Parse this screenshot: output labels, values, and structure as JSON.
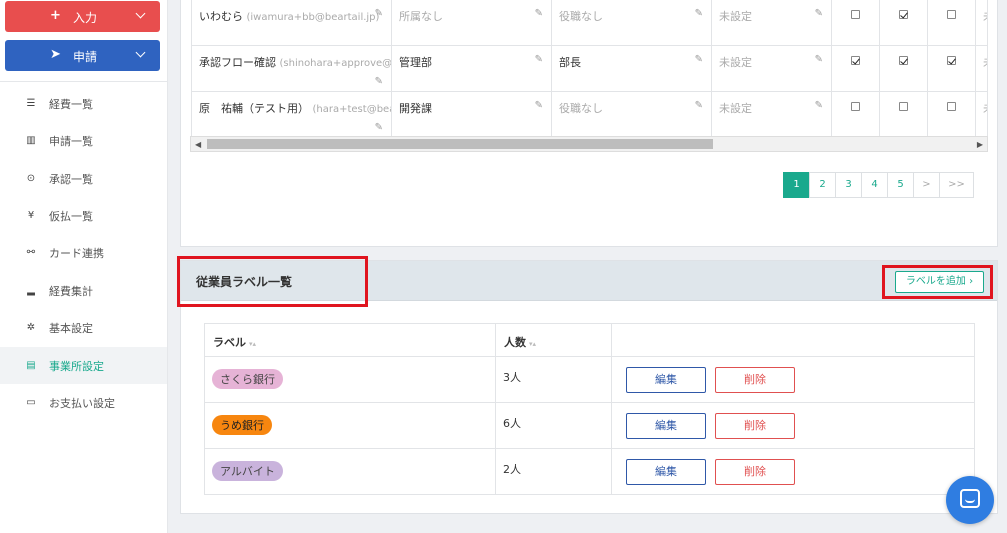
{
  "sidebar": {
    "input_button": {
      "icon": "+",
      "label": "入力"
    },
    "apply_button": {
      "icon": "➤",
      "label": "申請"
    },
    "items": [
      {
        "label": "経費一覧",
        "icon": "list-icon",
        "glyph": "☰"
      },
      {
        "label": "申請一覧",
        "icon": "bar-chart-icon",
        "glyph": "▥"
      },
      {
        "label": "承認一覧",
        "icon": "check-circle-icon",
        "glyph": "⊙"
      },
      {
        "label": "仮払一覧",
        "icon": "yen-icon",
        "glyph": "¥"
      },
      {
        "label": "カード連携",
        "icon": "link-icon",
        "glyph": "⚯"
      },
      {
        "label": "経費集計",
        "icon": "signal-icon",
        "glyph": "▂"
      },
      {
        "label": "基本設定",
        "icon": "gear-icon",
        "glyph": "✲"
      },
      {
        "label": "事業所設定",
        "icon": "building-icon",
        "glyph": "▤",
        "active": true
      },
      {
        "label": "お支払い設定",
        "icon": "credit-card-icon",
        "glyph": "▭"
      }
    ]
  },
  "users_table": {
    "rows": [
      {
        "name": "いわむら",
        "email": "(iwamura+bb@beartail.jp)",
        "department": "所属なし",
        "department_muted": true,
        "position": "役職なし",
        "position_muted": true,
        "setting": "未設定",
        "checks": [
          false,
          true,
          false
        ],
        "trailing": "未"
      },
      {
        "name": "承認フロー確認",
        "email": "(shinohara+approve@bea",
        "department": "管理部",
        "department_muted": false,
        "position": "部長",
        "position_muted": false,
        "setting": "未設定",
        "checks": [
          true,
          true,
          true
        ],
        "trailing": "未"
      },
      {
        "name": "原　祐輔（テスト用）",
        "email": "(hara+test@bear",
        "department": "開発課",
        "department_muted": false,
        "position": "役職なし",
        "position_muted": true,
        "setting": "未設定",
        "checks": [
          false,
          false,
          false
        ],
        "trailing": "未"
      }
    ]
  },
  "pagination": {
    "pages": [
      "1",
      "2",
      "3",
      "4",
      "5"
    ],
    "current": "1",
    "next": ">",
    "last": ">>"
  },
  "labels_section": {
    "title": "従業員ラベル一覧",
    "add_button": "ラベルを追加 ›",
    "columns": {
      "label": "ラベル",
      "count": "人数",
      "sort_glyph": "▾▴"
    },
    "rows": [
      {
        "label": "さくら銀行",
        "color": "#e6b3d6",
        "count": "3人",
        "edit": "編集",
        "delete": "削除"
      },
      {
        "label": "うめ銀行",
        "color": "#f7860f",
        "count": "6人",
        "edit": "編集",
        "delete": "削除"
      },
      {
        "label": "アルバイト",
        "color": "#c9b3dc",
        "count": "2人",
        "edit": "編集",
        "delete": "削除"
      }
    ]
  },
  "colors": {
    "accent": "#1aa98d",
    "input_button": "#e84e4e",
    "apply_button": "#2f63c0",
    "highlight": "#e0151f",
    "edit": "#2f58a8",
    "delete": "#e05050"
  }
}
